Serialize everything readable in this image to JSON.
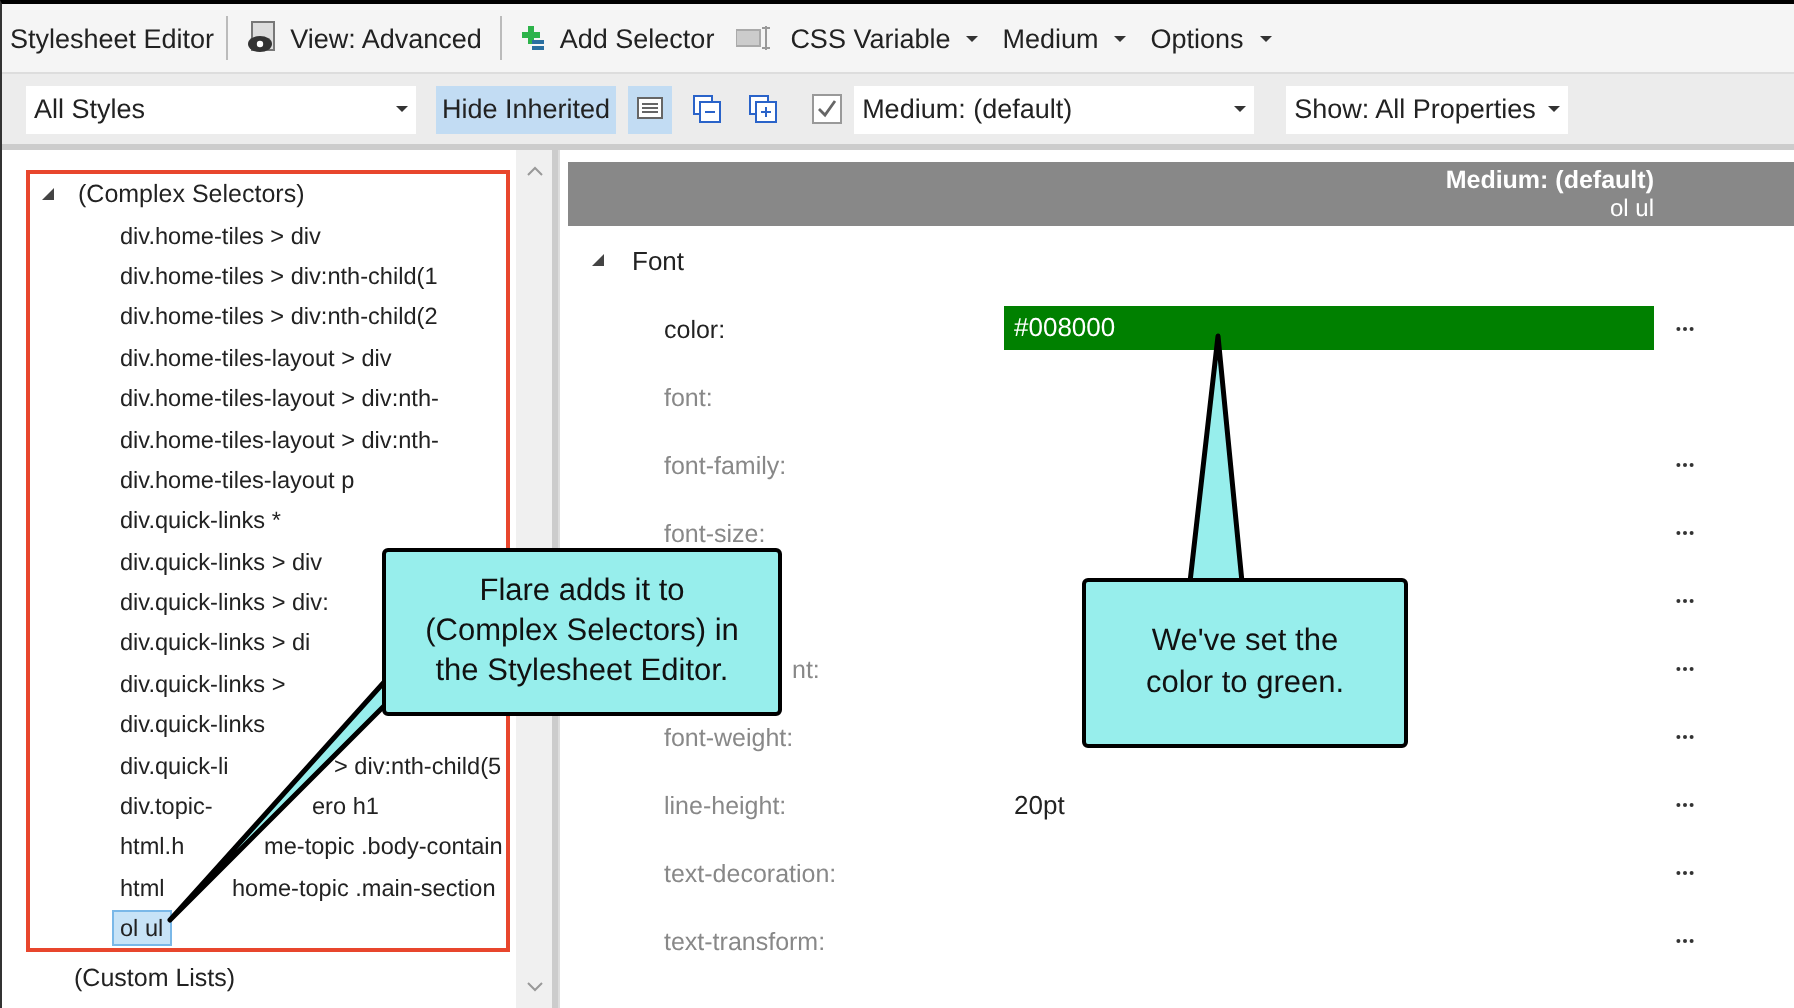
{
  "toolbar": {
    "title": "Stylesheet Editor",
    "items": [
      {
        "kind": "view",
        "label": "View: Advanced"
      },
      {
        "kind": "add",
        "label": "Add Selector"
      },
      {
        "kind": "variable",
        "label": "CSS Variable"
      },
      {
        "kind": "menu",
        "label": "Medium"
      },
      {
        "kind": "menu",
        "label": "Options"
      }
    ]
  },
  "filter_bar": {
    "styles_select": "All Styles",
    "hide_inherited": {
      "label": "Hide Inherited",
      "selected": true
    },
    "view_toggle": {
      "selected": true
    },
    "medium_check": {
      "label": "Medium: (default)",
      "checked": true
    },
    "show_select": "Show: All Properties"
  },
  "tree": [
    {
      "label": "(Complex Selectors)",
      "expanded": true,
      "highlighted": true,
      "children": [
        {
          "label": "div.home-tiles > div",
          "selected": false
        },
        {
          "label": "div.home-tiles > div:nth-child(1",
          "selected": false
        },
        {
          "label": "div.home-tiles > div:nth-child(2",
          "selected": false
        },
        {
          "label": "div.home-tiles-layout > div",
          "selected": false
        },
        {
          "label": "div.home-tiles-layout > div:nth-",
          "selected": false
        },
        {
          "label": "div.home-tiles-layout > div:nth-",
          "selected": false
        },
        {
          "label": "div.home-tiles-layout p",
          "selected": false
        },
        {
          "label": "div.quick-links *",
          "selected": false
        },
        {
          "label": "div.quick-links > div",
          "selected": false
        },
        {
          "label": "div.quick-links > div:",
          "selected": false
        },
        {
          "label": "div.quick-links > di",
          "selected": false
        },
        {
          "label": "div.quick-links >",
          "selected": false
        },
        {
          "label": "div.quick-links",
          "selected": false
        },
        {
          "label": "div.quick-li",
          "tail": "> div:nth-child(5",
          "selected": false
        },
        {
          "label": "div.topic-",
          "tail": "ero h1",
          "selected": false
        },
        {
          "label": "html.h",
          "tail": "me-topic .body-contain",
          "selected": false
        },
        {
          "label": "html",
          "tail": "home-topic .main-section",
          "selected": false
        },
        {
          "label": "ol ul",
          "selected": true
        }
      ]
    },
    {
      "label": "(Custom Lists)",
      "highlighted": false
    }
  ],
  "properties": {
    "header": {
      "medium": "Medium: (default)",
      "selector": "ol ul"
    },
    "section": {
      "label": "Font",
      "expanded": true
    },
    "rows": [
      {
        "kind": "property",
        "label": "color:",
        "set": true,
        "value": "#008000",
        "color": "#008000",
        "more": true
      },
      {
        "kind": "property",
        "label": "font:",
        "set": false,
        "more": false
      },
      {
        "kind": "property",
        "label": "font-family:",
        "set": false,
        "more": true
      },
      {
        "kind": "property",
        "label": "font-size:",
        "set": false,
        "more": true
      },
      {
        "kind": "covered",
        "more": true
      },
      {
        "kind": "covered",
        "label": "nt:",
        "set": false,
        "more": true
      },
      {
        "kind": "property",
        "label": "font-weight:",
        "set": false,
        "more": true
      },
      {
        "kind": "property",
        "label": "line-height:",
        "set": false,
        "value": "20pt",
        "more": true
      },
      {
        "kind": "property",
        "label": "text-decoration:",
        "set": false,
        "more": true
      },
      {
        "kind": "property",
        "label": "text-transform:",
        "set": false,
        "more": true
      }
    ]
  },
  "callouts": [
    {
      "kind": "left",
      "text": "Flare adds it to (Complex Selectors) in the Stylesheet Editor."
    },
    {
      "kind": "up",
      "text": "We've set the color to green."
    }
  ]
}
